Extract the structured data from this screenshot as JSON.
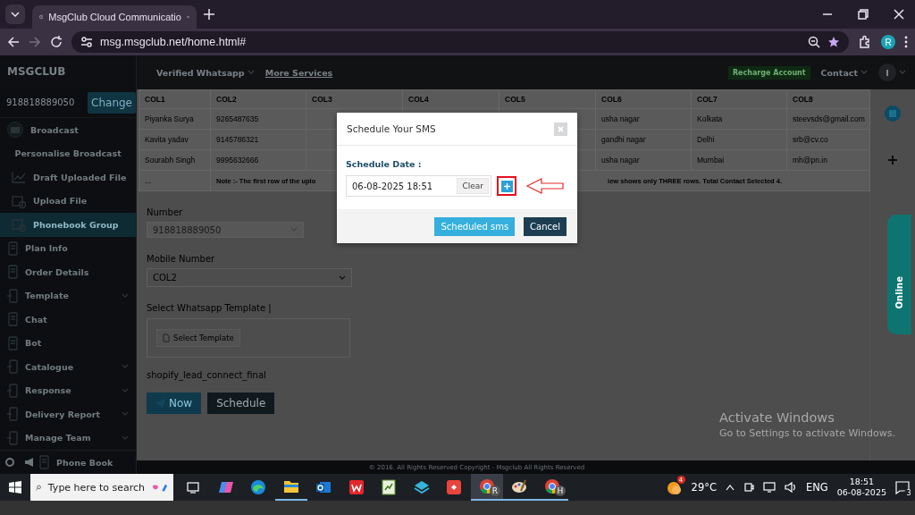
{
  "browser": {
    "tab_title": "MsgClub Cloud Communicatio",
    "url": "msg.msgclub.net/home.html#",
    "profile_letter": "R"
  },
  "header": {
    "logo": "MSGCLUB",
    "nav": [
      {
        "label": "Verified Whatsapp",
        "kind": "dropdown"
      },
      {
        "label": "More Services",
        "kind": "link"
      }
    ],
    "recharge": "Recharge Account",
    "contact": "Contact",
    "avatar_letter": "I"
  },
  "sidebar": {
    "account": "918818889050",
    "change_button": "Change",
    "items": [
      {
        "label": "Broadcast",
        "kind": "envelope",
        "selected": false
      },
      {
        "label": "Personalise Broadcast",
        "kind": "device",
        "selected": false,
        "expanded": true,
        "children": [
          {
            "label": "Draft Uploaded File",
            "kind": "chart",
            "selected": false
          },
          {
            "label": "Upload File",
            "kind": "calendar",
            "selected": false
          },
          {
            "label": "Phonebook Group",
            "kind": "calendar",
            "selected": true
          }
        ]
      },
      {
        "label": "Plan Info",
        "kind": "tablet",
        "selected": false
      },
      {
        "label": "Order Details",
        "kind": "tablet",
        "selected": false
      },
      {
        "label": "Template",
        "kind": "device",
        "selected": false,
        "expanded": false
      },
      {
        "label": "Chat",
        "kind": "tablet",
        "selected": false
      },
      {
        "label": "Bot",
        "kind": "tablet",
        "selected": false
      },
      {
        "label": "Catalogue",
        "kind": "device",
        "selected": false,
        "expanded": false
      },
      {
        "label": "Response",
        "kind": "device",
        "selected": false,
        "expanded": false
      },
      {
        "label": "Delivery Report",
        "kind": "device",
        "selected": false,
        "expanded": false
      },
      {
        "label": "Manage Team",
        "kind": "device",
        "selected": false,
        "expanded": false
      },
      {
        "label": "Phone Book",
        "kind": "tablet",
        "selected": false
      }
    ]
  },
  "table": {
    "columns": [
      "COL1",
      "COL2",
      "COL3",
      "COL4",
      "COL5",
      "COL6",
      "COL7",
      "COL8"
    ],
    "rows": [
      {
        "cells": [
          "Piyanka Surya",
          "9265487635",
          null,
          null,
          null,
          "usha nagar",
          "Kolkata",
          "steevsds@gmail.com"
        ]
      },
      {
        "cells": [
          "Kavita yadav",
          "9145786321",
          null,
          null,
          null,
          "gandhi nagar",
          "Delhi",
          "srb@cv.co"
        ]
      },
      {
        "cells": [
          "Sourabh Singh",
          "9995632666",
          null,
          null,
          null,
          "usha nagar",
          "Mumbai",
          "mh@pn.in"
        ]
      }
    ],
    "note_row": {
      "first_cell": "...",
      "note_start": "Note :- The first row of the uplo",
      "note_end": "iew shows only THREE rows. Total Contact Selected 4."
    }
  },
  "form": {
    "number_label": "Number",
    "number_value": "918818889050",
    "mobile_label": "Mobile Number",
    "mobile_value": "COL2",
    "template_label": "Select Whatsapp Template |",
    "template_button": "Select Template",
    "template_name": "shopify_lead_connect_final",
    "now_button": "Now",
    "schedule_button": "Schedule"
  },
  "online_tab": "Online",
  "footer": "© 2016. All Rights Reserved Copyright - Msgclub All Rights Reserved",
  "modal": {
    "title": "Schedule Your SMS",
    "date_label": "Schedule Date :",
    "date_value": "06-08-2025 18:51",
    "clear_button": "Clear",
    "submit_button": "Scheduled sms",
    "cancel_button": "Cancel"
  },
  "watermark": {
    "title": "Activate Windows",
    "subtitle": "Go to Settings to activate Windows."
  },
  "taskbar": {
    "search_placeholder": "Type here to search",
    "apps": [
      {
        "kind": "taskview",
        "running": false,
        "selected": false
      },
      {
        "kind": "copilot",
        "running": false,
        "selected": false
      },
      {
        "kind": "edge",
        "running": false,
        "selected": false
      },
      {
        "kind": "folder",
        "running": true,
        "selected": false
      },
      {
        "kind": "mail",
        "running": false,
        "selected": false
      },
      {
        "kind": "office",
        "running": false,
        "selected": false
      },
      {
        "kind": "sheet",
        "running": false,
        "selected": false
      },
      {
        "kind": "layers",
        "running": false,
        "selected": false
      },
      {
        "kind": "remote",
        "running": false,
        "selected": false
      },
      {
        "kind": "chrome",
        "badge": "R",
        "running": true,
        "selected": true
      },
      {
        "kind": "paint",
        "running": true,
        "selected": false
      },
      {
        "kind": "chrome",
        "badge": "H",
        "running": true,
        "selected": false
      }
    ],
    "weather_badge": "4",
    "temperature": "29°C",
    "language": "ENG",
    "time": "18:51",
    "date": "06-08-2025",
    "notifications": "3"
  }
}
